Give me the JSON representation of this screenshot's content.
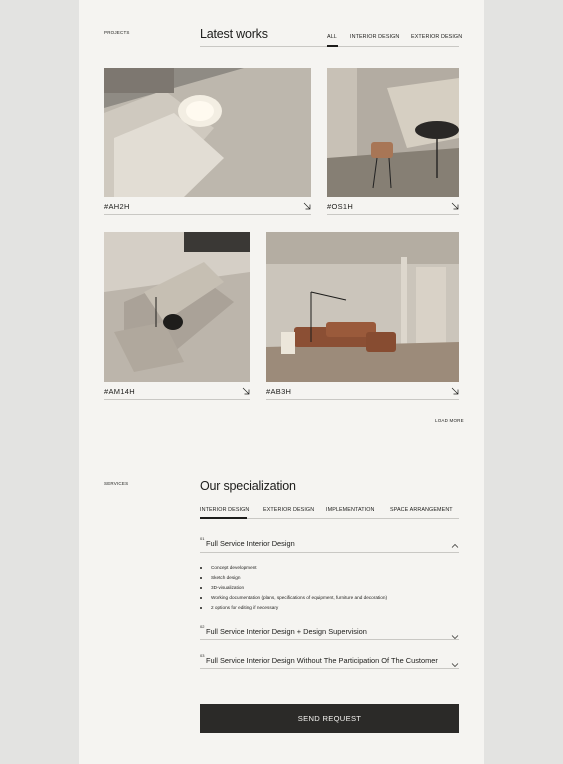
{
  "projects": {
    "section_label": "PROJECTS",
    "title": "Latest works",
    "tabs": [
      {
        "label": "ALL",
        "active": true
      },
      {
        "label": "INTERIOR DESIGN",
        "active": false
      },
      {
        "label": "EXTERIOR DESIGN",
        "active": false
      }
    ],
    "cards": [
      {
        "code": "#AH2H",
        "icon": "arrow-down-right-icon"
      },
      {
        "code": "#OS1H",
        "icon": "arrow-down-right-icon"
      },
      {
        "code": "#AM14H",
        "icon": "arrow-down-right-icon"
      },
      {
        "code": "#AB3H",
        "icon": "arrow-down-right-icon"
      }
    ],
    "load_more": "LOAD MORE"
  },
  "services": {
    "section_label": "SERVICES",
    "title": "Our specialization",
    "tabs": [
      {
        "label": "INTERIOR DESIGN",
        "active": true
      },
      {
        "label": "EXTERIOR DESIGN",
        "active": false
      },
      {
        "label": "IMPLEMENTATION",
        "active": false
      },
      {
        "label": "SPACE ARRANGEMENT",
        "active": false
      }
    ],
    "accordion": [
      {
        "number": "01",
        "title": "Full Service Interior Design",
        "expanded": true,
        "icon": "chevron-up-icon",
        "items": [
          "Concept development",
          "Sketch design",
          "3D-visualization",
          "Working documentation (plans, specifications of equipment, furniture and decoration)",
          "2 options for editing if necessary"
        ]
      },
      {
        "number": "02",
        "title": "Full Service Interior Design + Design Supervision",
        "expanded": false,
        "icon": "chevron-down-icon"
      },
      {
        "number": "03",
        "title": "Full Service Interior Design Without The Participation Of The Customer",
        "expanded": false,
        "icon": "chevron-down-icon"
      }
    ],
    "send_button": "SEND REQUEST"
  },
  "colors": {
    "page_bg": "#f5f4f1",
    "outer_bg": "#e3e3e1",
    "text": "#1d1d1b",
    "button_bg": "#2b2a28",
    "divider": "#c9c8c4"
  }
}
